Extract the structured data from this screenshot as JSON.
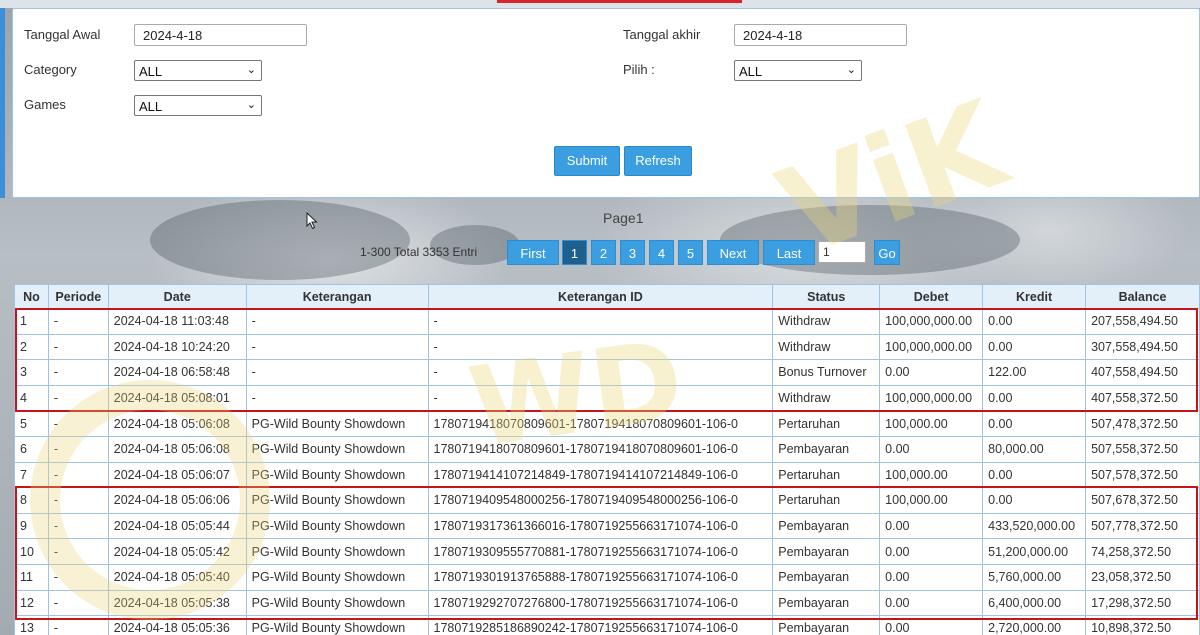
{
  "filters": {
    "start_label": "Tanggal Awal",
    "start_value": "2024-4-18",
    "end_label": "Tanggal akhir",
    "end_value": "2024-4-18",
    "category_label": "Category",
    "category_value": "ALL",
    "pilih_label": "Pilih  :",
    "pilih_value": "ALL",
    "games_label": "Games",
    "games_value": "ALL",
    "submit_label": "Submit",
    "refresh_label": "Refresh"
  },
  "pager": {
    "title": "Page1",
    "info": "1-300 Total 3353 Entri",
    "first": "First",
    "pages": [
      "1",
      "2",
      "3",
      "4",
      "5"
    ],
    "next": "Next",
    "last": "Last",
    "goto_value": "1",
    "go": "Go"
  },
  "table": {
    "headers": [
      "No",
      "Periode",
      "Date",
      "Keterangan",
      "Keterangan ID",
      "Status",
      "Debet",
      "Kredit",
      "Balance"
    ],
    "rows": [
      [
        "1",
        "-",
        "2024-04-18 11:03:48",
        "-",
        "-",
        "Withdraw",
        "100,000,000.00",
        "0.00",
        "207,558,494.50"
      ],
      [
        "2",
        "-",
        "2024-04-18 10:24:20",
        "-",
        "-",
        "Withdraw",
        "100,000,000.00",
        "0.00",
        "307,558,494.50"
      ],
      [
        "3",
        "-",
        "2024-04-18 06:58:48",
        "-",
        "-",
        "Bonus Turnover",
        "0.00",
        "122.00",
        "407,558,494.50"
      ],
      [
        "4",
        "-",
        "2024-04-18 05:08:01",
        "-",
        "-",
        "Withdraw",
        "100,000,000.00",
        "0.00",
        "407,558,372.50"
      ],
      [
        "5",
        "-",
        "2024-04-18 05:06:08",
        "PG-Wild Bounty Showdown",
        "1780719418070809601-1780719418070809601-106-0",
        "Pertaruhan",
        "100,000.00",
        "0.00",
        "507,478,372.50"
      ],
      [
        "6",
        "-",
        "2024-04-18 05:06:08",
        "PG-Wild Bounty Showdown",
        "1780719418070809601-1780719418070809601-106-0",
        "Pembayaran",
        "0.00",
        "80,000.00",
        "507,558,372.50"
      ],
      [
        "7",
        "-",
        "2024-04-18 05:06:07",
        "PG-Wild Bounty Showdown",
        "1780719414107214849-1780719414107214849-106-0",
        "Pertaruhan",
        "100,000.00",
        "0.00",
        "507,578,372.50"
      ],
      [
        "8",
        "-",
        "2024-04-18 05:06:06",
        "PG-Wild Bounty Showdown",
        "1780719409548000256-1780719409548000256-106-0",
        "Pertaruhan",
        "100,000.00",
        "0.00",
        "507,678,372.50"
      ],
      [
        "9",
        "-",
        "2024-04-18 05:05:44",
        "PG-Wild Bounty Showdown",
        "1780719317361366016-1780719255663171074-106-0",
        "Pembayaran",
        "0.00",
        "433,520,000.00",
        "507,778,372.50"
      ],
      [
        "10",
        "-",
        "2024-04-18 05:05:42",
        "PG-Wild Bounty Showdown",
        "1780719309555770881-1780719255663171074-106-0",
        "Pembayaran",
        "0.00",
        "51,200,000.00",
        "74,258,372.50"
      ],
      [
        "11",
        "-",
        "2024-04-18 05:05:40",
        "PG-Wild Bounty Showdown",
        "1780719301913765888-1780719255663171074-106-0",
        "Pembayaran",
        "0.00",
        "5,760,000.00",
        "23,058,372.50"
      ],
      [
        "12",
        "-",
        "2024-04-18 05:05:38",
        "PG-Wild Bounty Showdown",
        "1780719292707276800-1780719255663171074-106-0",
        "Pembayaran",
        "0.00",
        "6,400,000.00",
        "17,298,372.50"
      ],
      [
        "13",
        "-",
        "2024-04-18 05:05:36",
        "PG-Wild Bounty Showdown",
        "1780719285186890242-1780719255663171074-106-0",
        "Pembayaran",
        "0.00",
        "2,720,000.00",
        "10,898,372.50"
      ]
    ],
    "withdraw_rows": [
      0,
      1,
      3
    ]
  },
  "colors": {
    "accent": "#3b9ee0",
    "negative": "#d0202a",
    "highlight_box": "#c4141c"
  }
}
